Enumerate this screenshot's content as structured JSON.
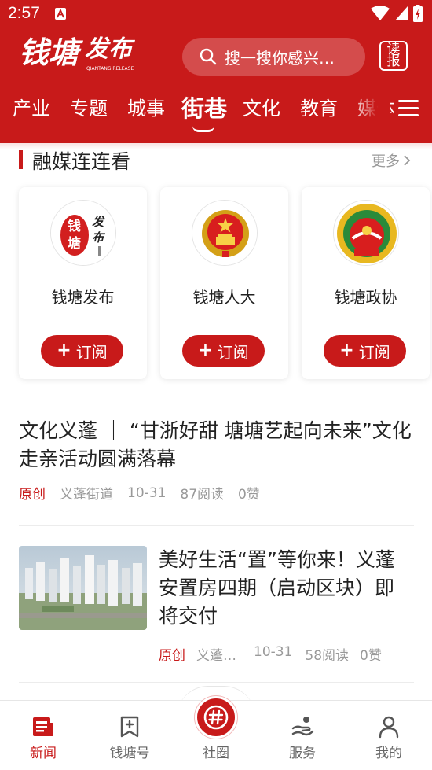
{
  "status": {
    "time": "2:57"
  },
  "header": {
    "logo_text": "钱塘发布",
    "logo_sub": "QIANTANG RELEASE",
    "search_placeholder": "搜一搜你感兴…",
    "reader_label": "读报"
  },
  "tabs": {
    "items": [
      "产业",
      "专题",
      "城事",
      "街巷",
      "文化",
      "教育",
      "媒体"
    ],
    "active": "街巷"
  },
  "section": {
    "title": "融媒连连看",
    "more": "更多"
  },
  "cards": [
    {
      "name": "钱塘发布",
      "button": "订阅"
    },
    {
      "name": "钱塘人大",
      "button": "订阅"
    },
    {
      "name": "钱塘政协",
      "button": "订阅"
    }
  ],
  "news": [
    {
      "title": "文化义蓬 ｜ “甘浙好甜 塘塘艺起向未来”文化走亲活动圆满落幕",
      "tag": "原创",
      "source": "义蓬街道",
      "date": "10-31",
      "reads": "87阅读",
      "likes": "0赞"
    },
    {
      "title": "美好生活“置”等你来！义蓬安置房四期（启动区块）即将交付",
      "tag": "原创",
      "source": "义蓬…",
      "date": "10-31",
      "reads": "58阅读",
      "likes": "0赞"
    }
  ],
  "bottom_nav": {
    "items": [
      {
        "label": "新闻",
        "icon": "news-icon"
      },
      {
        "label": "钱塘号",
        "icon": "bookmark-plus-icon"
      },
      {
        "label": "社圈",
        "icon": "hashtag-icon"
      },
      {
        "label": "服务",
        "icon": "service-hand-icon"
      },
      {
        "label": "我的",
        "icon": "person-icon"
      }
    ],
    "active": "新闻"
  },
  "colors": {
    "brand_red": "#c81a1a"
  }
}
